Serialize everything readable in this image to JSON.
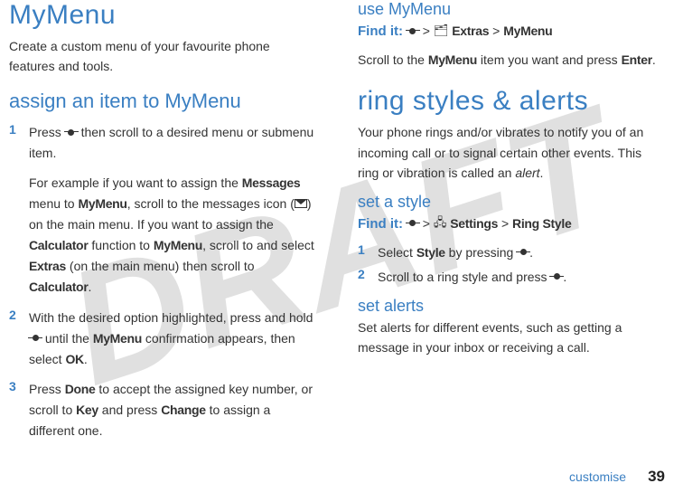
{
  "watermark": "DRAFT",
  "left": {
    "title": "MyMenu",
    "intro": "Create a custom menu of your favourite phone features and tools.",
    "section1": {
      "heading": "assign an item to MyMenu",
      "steps": [
        {
          "num": "1",
          "p1_a": "Press ",
          "p1_b": " then scroll to a desired menu or submenu item.",
          "p2_a": "For example if you want to assign the ",
          "p2_messages": "Messages",
          "p2_b": " menu to ",
          "p2_mymenu": "MyMenu",
          "p2_c": ", scroll to the messages icon (",
          "p2_d": ") on the main menu. If you want to assign the ",
          "p2_calc": "Calculator",
          "p2_e": " function to ",
          "p2_mymenu2": "MyMenu",
          "p2_f": ", scroll to and select ",
          "p2_extras": "Extras",
          "p2_g": " (on the main menu) then scroll to ",
          "p2_calc2": "Calculator",
          "p2_h": "."
        },
        {
          "num": "2",
          "p1_a": "With the desired option highlighted, press and hold ",
          "p1_b": " until the ",
          "p1_mymenu": "MyMenu",
          "p1_c": " confirmation appears, then select ",
          "p1_ok": "OK",
          "p1_d": "."
        },
        {
          "num": "3",
          "p1_a": "Press ",
          "p1_done": "Done",
          "p1_b": " to accept the assigned key number, or scroll to ",
          "p1_key": "Key",
          "p1_c": " and press ",
          "p1_change": "Change",
          "p1_d": " to assign a different one."
        }
      ]
    }
  },
  "right": {
    "section_use": {
      "heading": "use MyMenu",
      "findit_label": "Find it:",
      "gt": ">",
      "extras": "Extras",
      "mymenu": "MyMenu",
      "body_a": "Scroll to the ",
      "body_mymenu": "MyMenu",
      "body_b": " item you want and press ",
      "body_enter": "Enter",
      "body_c": "."
    },
    "ring": {
      "title": "ring styles & alerts",
      "intro_a": "Your phone rings and/or vibrates to notify you of an incoming call or to signal certain other events. This ring or vibration is called an ",
      "intro_alert": "alert",
      "intro_b": "."
    },
    "setstyle": {
      "heading": "set a style",
      "findit_label": "Find it:",
      "gt": ">",
      "settings": "Settings",
      "ringstyle": "Ring Style",
      "steps": [
        {
          "num": "1",
          "a": "Select ",
          "style": "Style",
          "b": " by pressing ",
          "c": "."
        },
        {
          "num": "2",
          "a": "Scroll to a ring style and press ",
          "b": "."
        }
      ]
    },
    "setalerts": {
      "heading": "set alerts",
      "body": "Set alerts for different events, such as getting a message in your inbox or receiving a call."
    }
  },
  "footer": {
    "word": "customise",
    "page": "39"
  }
}
